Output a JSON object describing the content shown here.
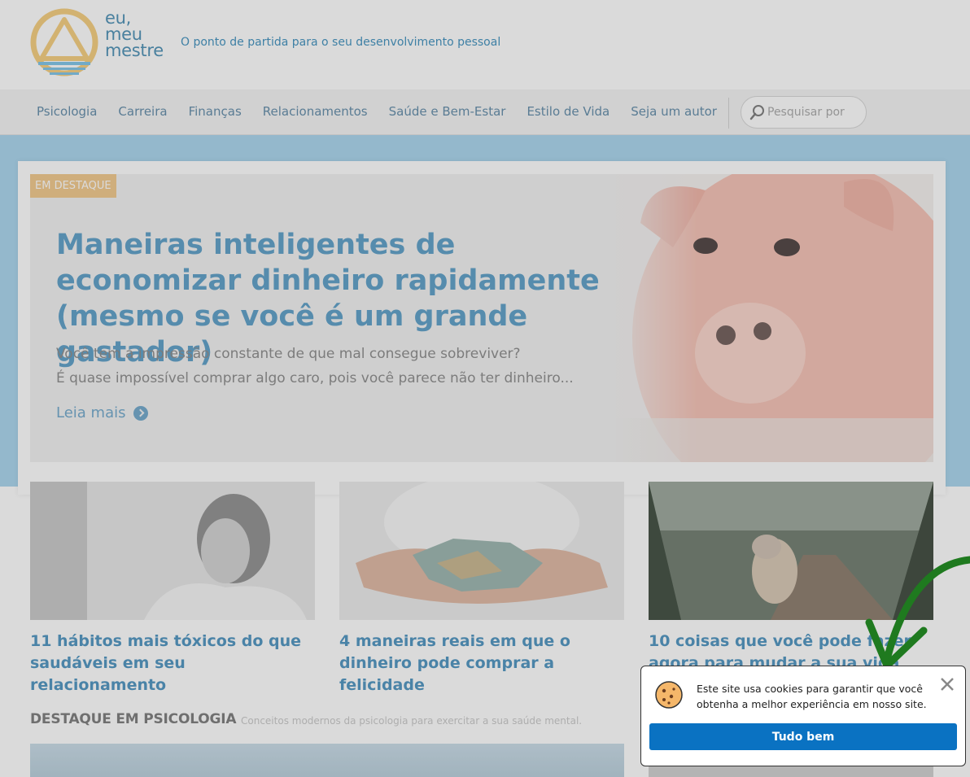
{
  "header": {
    "logo_words": [
      "eu,",
      "meu",
      "mestre"
    ],
    "tagline": "O ponto de partida para o seu desenvolvimento pessoal"
  },
  "nav": {
    "items": [
      "Psicologia",
      "Carreira",
      "Finanças",
      "Relacionamentos",
      "Saúde e Bem-Estar",
      "Estilo de Vida",
      "Seja um autor"
    ],
    "search_placeholder": "Pesquisar por"
  },
  "featured": {
    "badge": "EM DESTAQUE",
    "title": "Maneiras inteligentes de economizar dinheiro rapidamente (mesmo se você é um grande gastador)",
    "excerpt_line1": "Você tem a impressão constante de que mal consegue sobreviver?",
    "excerpt_line2": "É quase impossível comprar algo caro, pois você parece não ter dinheiro...",
    "read_more": "Leia mais"
  },
  "articles": [
    {
      "title": "11 hábitos mais tóxicos do que saudáveis em seu relacionamento"
    },
    {
      "title": "4 maneiras reais em que o dinheiro pode comprar a felicidade"
    },
    {
      "title": "10 coisas que você pode fazer agora para mudar a sua vida para sempre"
    }
  ],
  "section": {
    "title": "DESTAQUE EM PSICOLOGIA",
    "subtitle": "Conceitos modernos da psicologia para exercitar a sua saúde mental."
  },
  "cookie": {
    "message": "Este site usa cookies para garantir que você obtenha a melhor experiência em nosso site.",
    "button": "Tudo bem"
  },
  "colors": {
    "accent_blue": "#4c93c0",
    "band_blue": "#a8d5ee",
    "button_blue": "#0a72c2",
    "badge_orange": "#f2c88a",
    "arrow_green": "#1f7a1f"
  }
}
